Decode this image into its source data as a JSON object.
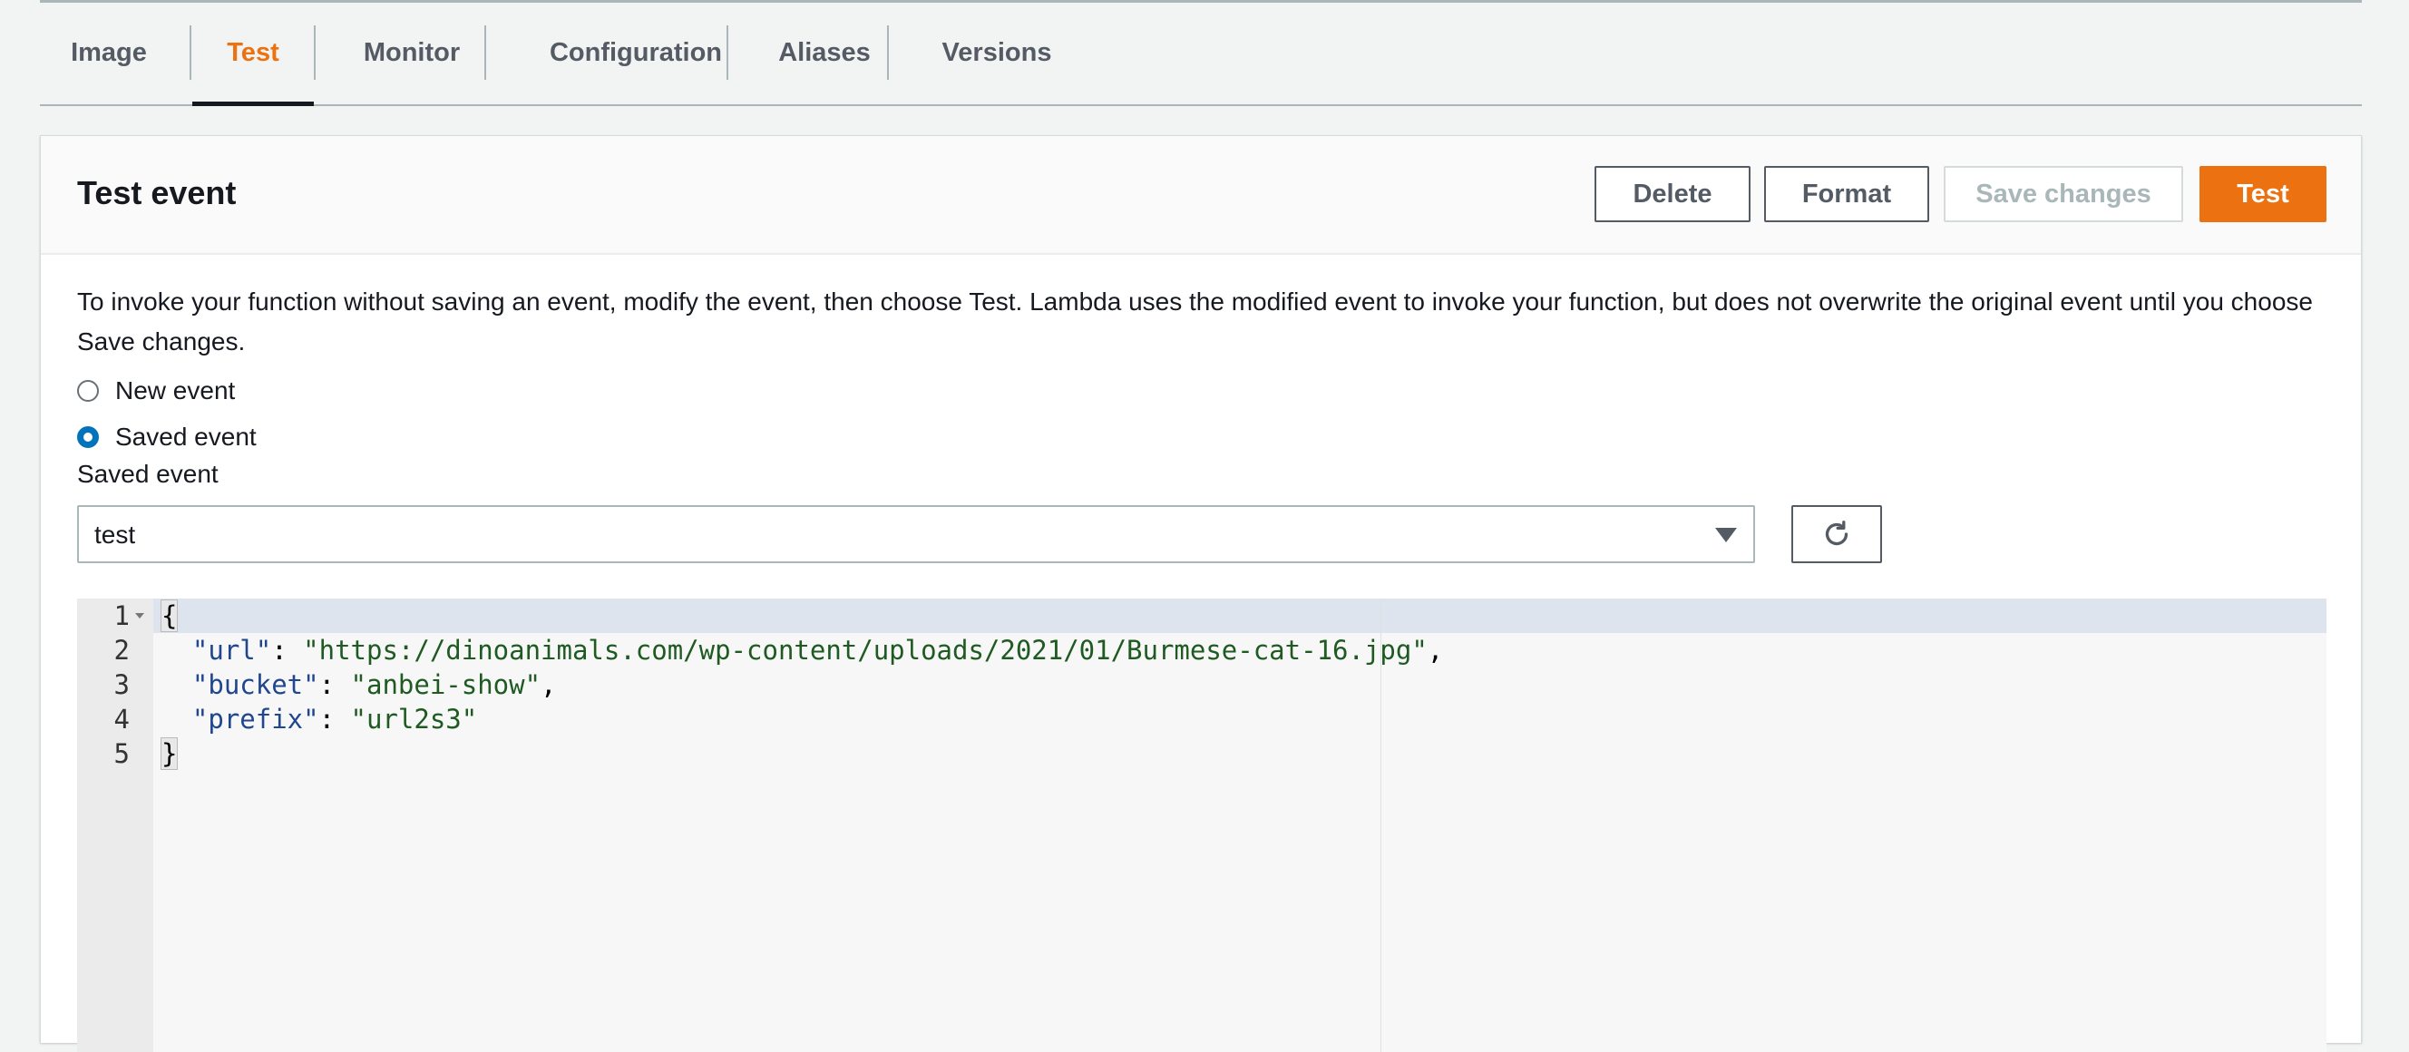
{
  "tabs": [
    {
      "label": "Image"
    },
    {
      "label": "Test",
      "active": true
    },
    {
      "label": "Monitor"
    },
    {
      "label": "Configuration"
    },
    {
      "label": "Aliases"
    },
    {
      "label": "Versions"
    }
  ],
  "panel": {
    "title": "Test event",
    "buttons": {
      "delete": "Delete",
      "format": "Format",
      "save_changes": "Save changes",
      "test": "Test"
    },
    "description": "To invoke your function without saving an event, modify the event, then choose Test. Lambda uses the modified event to invoke your function, but does not overwrite the original event until you choose Save changes.",
    "radio_options": [
      {
        "label": "New event",
        "checked": false
      },
      {
        "label": "Saved event",
        "checked": true
      }
    ],
    "saved_event_label": "Saved event",
    "saved_event_value": "test",
    "refresh_icon": "refresh-icon"
  },
  "editor": {
    "line_numbers": [
      "1",
      "2",
      "3",
      "4",
      "5"
    ],
    "lines": {
      "open_brace": "{",
      "url_key": "\"url\"",
      "url_value": "\"https://dinoanimals.com/wp-content/uploads/2021/01/Burmese-cat-16.jpg\"",
      "bucket_key": "\"bucket\"",
      "bucket_value": "\"anbei-show\"",
      "prefix_key": "\"prefix\"",
      "prefix_value": "\"url2s3\"",
      "close_brace": "}"
    }
  },
  "colors": {
    "accent": "#ec7211",
    "radio_selected": "#0073bb",
    "json_key": "#20468f",
    "json_string": "#1e5a21"
  }
}
